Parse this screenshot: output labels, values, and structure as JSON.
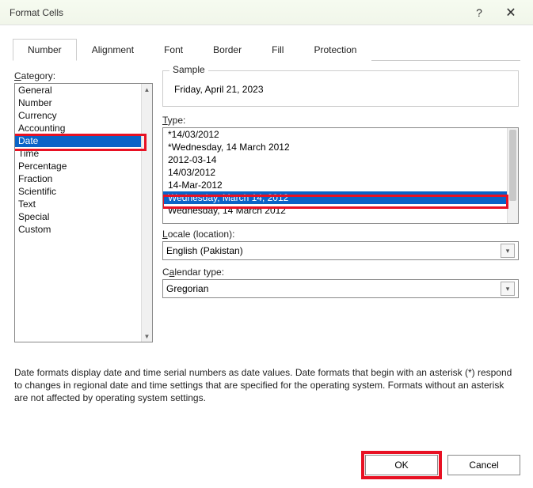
{
  "window": {
    "title": "Format Cells",
    "help": "?",
    "close": "🗙"
  },
  "tabs": [
    "Number",
    "Alignment",
    "Font",
    "Border",
    "Fill",
    "Protection"
  ],
  "activeTab": 0,
  "categoryLabel": {
    "u": "C",
    "rest": "ategory:"
  },
  "categories": [
    "General",
    "Number",
    "Currency",
    "Accounting",
    "Date",
    "Time",
    "Percentage",
    "Fraction",
    "Scientific",
    "Text",
    "Special",
    "Custom"
  ],
  "selectedCategoryIndex": 4,
  "sample": {
    "legend": "Sample",
    "value": "Friday, April 21, 2023"
  },
  "typeLabel": {
    "u": "T",
    "rest": "ype:"
  },
  "types": [
    "*14/03/2012",
    "*Wednesday, 14 March 2012",
    "2012-03-14",
    "14/03/2012",
    "14-Mar-2012",
    "Wednesday, March 14, 2012",
    "Wednesday, 14 March 2012"
  ],
  "selectedTypeIndex": 5,
  "localeLabel": {
    "u": "L",
    "rest": "ocale (location):"
  },
  "localeValue": "English (Pakistan)",
  "calLabel": {
    "pre": "C",
    "u": "a",
    "rest": "lendar type:"
  },
  "calValue": "Gregorian",
  "description": "Date formats display date and time serial numbers as date values.  Date formats that begin with an asterisk (*) respond to changes in regional date and time settings that are specified for the operating system.  Formats without an asterisk are not affected by operating system settings.",
  "buttons": {
    "ok": "OK",
    "cancel": "Cancel"
  }
}
